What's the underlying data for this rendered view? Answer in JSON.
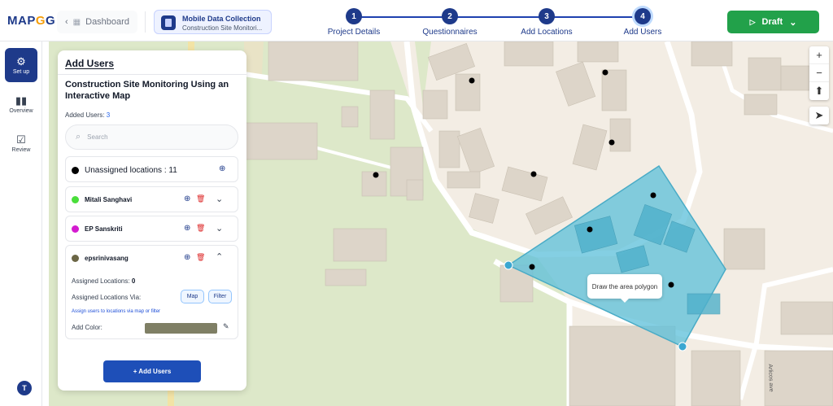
{
  "app": {
    "logo_text": "MAP",
    "logo_pin": "G",
    "logo_tail": "G",
    "back_label": "Dashboard",
    "project_title": "Mobile Data Collection",
    "project_subtitle": "Construction Site Monitori..."
  },
  "steps": [
    {
      "number": "1",
      "label": "Project Details"
    },
    {
      "number": "2",
      "label": "Questionnaires"
    },
    {
      "number": "3",
      "label": "Add Locations"
    },
    {
      "number": "4",
      "label": "Add Users"
    }
  ],
  "draft": {
    "label": "Draft",
    "icon": "play-icon"
  },
  "rail": {
    "items": [
      {
        "label": "Set up",
        "icon": "gear-icon"
      },
      {
        "label": "Overview",
        "icon": "bar-chart-icon"
      },
      {
        "label": "Review",
        "icon": "checkbox-icon"
      }
    ],
    "avatar": "T"
  },
  "panel": {
    "title": "Add Users",
    "project_name": "Construction Site Monitoring Using an Interactive Map",
    "added_label": "Added Users:",
    "added_count": "3",
    "search_placeholder": "Search",
    "unassigned": {
      "label": "Unassigned locations : 11",
      "color": "#000000"
    },
    "users": [
      {
        "name": "Mitali Sanghavi",
        "color": "#4ade3a"
      },
      {
        "name": "EP Sanskriti",
        "color": "#d41bd0"
      },
      {
        "name": "epsrinivasang",
        "color": "#6b6645"
      }
    ],
    "details": {
      "assigned_label": "Assigned Locations:",
      "assigned_value": "0",
      "via_label": "Assigned Locations Via:",
      "map_btn": "Map",
      "filter_btn": "Filter",
      "hint": "Assign users to locations via map or filter",
      "color_label": "Add Color:",
      "color_value": "#7f7f65"
    },
    "add_button": "+ Add Users"
  },
  "map": {
    "tooltip": "Draw the area polygon",
    "street_label": "Arlicos ave",
    "controls": [
      "+",
      "−",
      "⬆"
    ],
    "locate": "➤",
    "polygon_color": "#5bbfd9"
  }
}
